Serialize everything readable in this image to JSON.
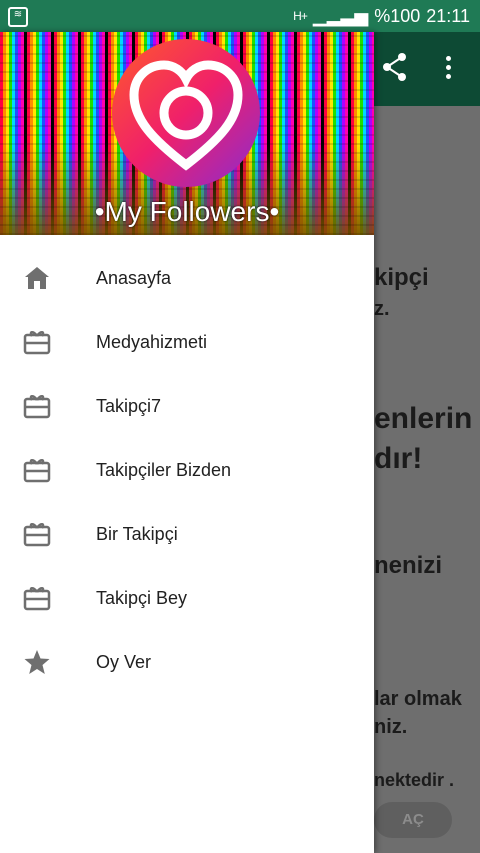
{
  "status_bar": {
    "network": "H+",
    "battery": "%100",
    "time": "21:11"
  },
  "drawer": {
    "title": "•My Followers•",
    "items": [
      {
        "label": "Anasayfa",
        "icon": "home-icon"
      },
      {
        "label": "Medyahizmeti",
        "icon": "gift-card-icon"
      },
      {
        "label": "Takipçi7",
        "icon": "gift-card-icon"
      },
      {
        "label": "Takipçiler Bizden",
        "icon": "gift-card-icon"
      },
      {
        "label": "Bir Takipçi",
        "icon": "gift-card-icon"
      },
      {
        "label": "Takipçi Bey",
        "icon": "gift-card-icon"
      },
      {
        "label": "Oy Ver",
        "icon": "star-icon"
      }
    ]
  },
  "background": {
    "lines": [
      "kipçi",
      "z.",
      "enlerin",
      "dır!",
      "nenizi",
      "lar olmak",
      "niz.",
      "nektedir ."
    ],
    "open_button": "AÇ"
  },
  "colors": {
    "status_bar": "#1f7a55",
    "toolbar": "#0d4a34",
    "icon_gray": "#6f6f6f"
  }
}
